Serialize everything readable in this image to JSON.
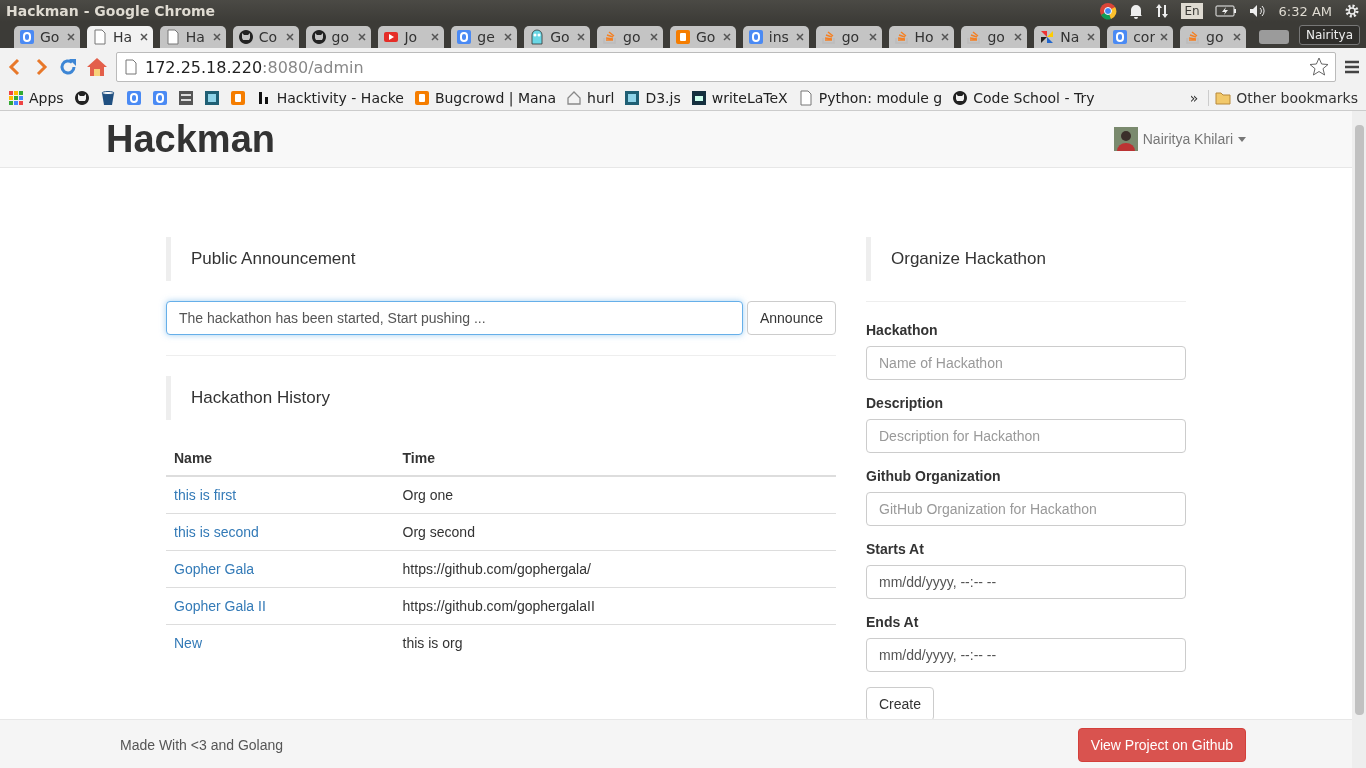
{
  "window": {
    "title": "Hackman - Google Chrome"
  },
  "system_tray": {
    "language": "En",
    "time": "6:32 AM"
  },
  "tabs": [
    {
      "label": "Go",
      "kind": "tile-blue",
      "selected": false
    },
    {
      "label": "Ha",
      "kind": "page",
      "selected": true
    },
    {
      "label": "Ha",
      "kind": "page",
      "selected": false
    },
    {
      "label": "Co",
      "kind": "cat",
      "selected": false
    },
    {
      "label": "go",
      "kind": "cat",
      "selected": false
    },
    {
      "label": "Jo",
      "kind": "play",
      "selected": false
    },
    {
      "label": "ge",
      "kind": "tile-blue",
      "selected": false
    },
    {
      "label": "Go",
      "kind": "gopher",
      "selected": false
    },
    {
      "label": "go",
      "kind": "stack",
      "selected": false
    },
    {
      "label": "Go",
      "kind": "tile-orange",
      "selected": false
    },
    {
      "label": "ins",
      "kind": "tile-blue",
      "selected": false
    },
    {
      "label": "go",
      "kind": "stack",
      "selected": false
    },
    {
      "label": "Ho",
      "kind": "stack",
      "selected": false
    },
    {
      "label": "go",
      "kind": "stack",
      "selected": false
    },
    {
      "label": "Na",
      "kind": "pinwheel",
      "selected": false
    },
    {
      "label": "cor",
      "kind": "tile-blue",
      "selected": false
    },
    {
      "label": "go",
      "kind": "stack",
      "selected": false
    }
  ],
  "profile": "Nairitya",
  "address_bar": {
    "host": "172.25.18.220",
    "path": ":8080/admin"
  },
  "bookmarks": [
    {
      "kind": "grid",
      "label": "Apps"
    },
    {
      "kind": "cat"
    },
    {
      "kind": "bucket"
    },
    {
      "kind": "tile-blue"
    },
    {
      "kind": "tile-blue"
    },
    {
      "kind": "tile-grey"
    },
    {
      "kind": "tile-teal"
    },
    {
      "kind": "tile-orange"
    },
    {
      "kind": "bar",
      "label": "Hacktivity - Hacke"
    },
    {
      "kind": "tile-orange",
      "label": "Bugcrowd | Mana"
    },
    {
      "kind": "house",
      "label": "hurl"
    },
    {
      "kind": "tile-teal",
      "label": "D3.js"
    },
    {
      "kind": "tile-dark",
      "label": "writeLaTeX"
    },
    {
      "kind": "page",
      "label": "Python: module g"
    },
    {
      "kind": "cat",
      "label": "Code School - Try"
    }
  ],
  "bookmarks_more": "»",
  "other_bookmarks": "Other bookmarks",
  "navbar": {
    "brand": "Hackman",
    "user": "Nairitya Khilari"
  },
  "announcement": {
    "heading": "Public Announcement",
    "value": "The hackathon has been started, Start pushing ...",
    "focused": true,
    "button": "Announce"
  },
  "history": {
    "heading": "Hackathon History",
    "columns": [
      "Name",
      "Time"
    ],
    "rows": [
      [
        "this is first",
        "Org one"
      ],
      [
        "this is second",
        "Org second"
      ],
      [
        "Gopher Gala",
        "https://github.com/gophergala/"
      ],
      [
        "Gopher Gala II",
        "https://github.com/gophergalaII"
      ],
      [
        "New",
        "this is org"
      ]
    ]
  },
  "organize": {
    "heading": "Organize Hackathon",
    "fields": [
      {
        "label": "Hackathon",
        "placeholder": "Name of Hackathon",
        "kind": "text"
      },
      {
        "label": "Description",
        "placeholder": "Description for Hackathon",
        "kind": "text"
      },
      {
        "label": "Github Organization",
        "placeholder": "GitHub Organization for Hackathon",
        "kind": "text"
      },
      {
        "label": "Starts At",
        "placeholder": "mm/dd/yyyy, --:-- --",
        "kind": "datetime"
      },
      {
        "label": "Ends At",
        "placeholder": "mm/dd/yyyy, --:-- --",
        "kind": "datetime"
      }
    ],
    "button": "Create"
  },
  "footer": {
    "text": "Made With <3 and Golang",
    "button": "View Project on Github"
  }
}
